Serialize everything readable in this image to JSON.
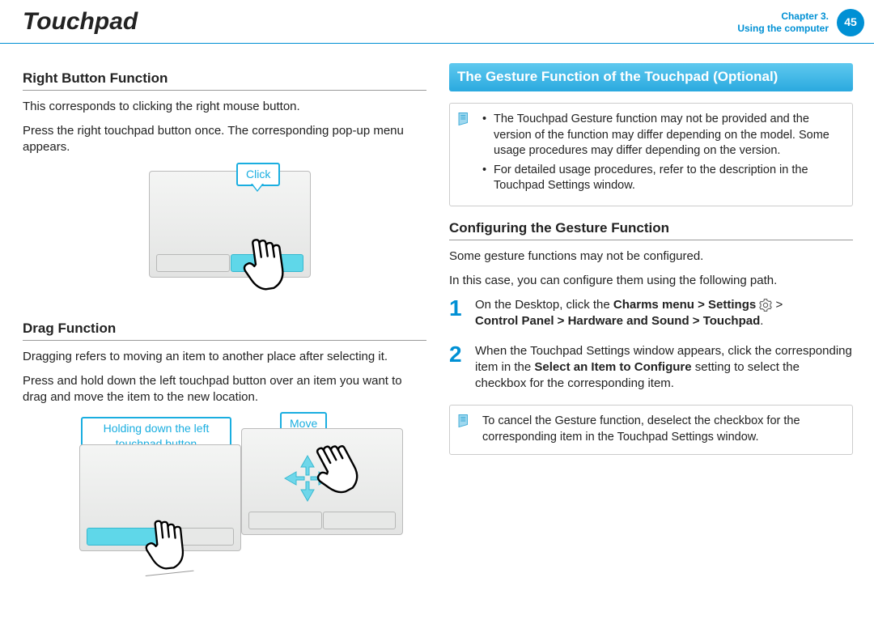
{
  "header": {
    "title": "Touchpad",
    "chapter": "Chapter 3.",
    "section": "Using the computer",
    "page": "45"
  },
  "left": {
    "rb_heading": "Right Button Function",
    "rb_p1": "This corresponds to clicking the right mouse button.",
    "rb_p2": "Press the right touchpad button once. The corresponding pop-up menu appears.",
    "drag_heading": "Drag Function",
    "drag_p1": "Dragging refers to moving an item to another place after selecting it.",
    "drag_p2": "Press and hold down the left touchpad button over an item you want to drag and move the item to the new location.",
    "callout_click": "Click",
    "callout_move": "Move",
    "callout_hold": "Holding down the left touchpad button"
  },
  "right": {
    "banner": "The Gesture Function of the Touchpad (Optional)",
    "note1_b1": "The Touchpad Gesture function may not be provided and the version of the function may differ depending on the model. Some usage procedures may differ depending on the version.",
    "note1_b2": "For detailed usage procedures, refer to the description in the Touchpad Settings window.",
    "cfg_heading": "Configuring the Gesture Function",
    "cfg_p1": "Some gesture functions may not be configured.",
    "cfg_p2": "In this case, you can configure them using the following path.",
    "step1_n": "1",
    "step1_t1": "On the Desktop, click the ",
    "step1_b1": "Charms menu > Settings ",
    "step1_t2": " > ",
    "step1_b2": "Control Panel > Hardware and Sound > Touchpad",
    "step1_t3": ".",
    "step2_n": "2",
    "step2_t1": "When the Touchpad Settings window appears, click the corresponding item in the ",
    "step2_b1": "Select an Item to Configure",
    "step2_t2": " setting to select the checkbox for the corresponding item.",
    "note2": "To cancel the Gesture function, deselect the checkbox for the corresponding item in the Touchpad Settings window."
  }
}
